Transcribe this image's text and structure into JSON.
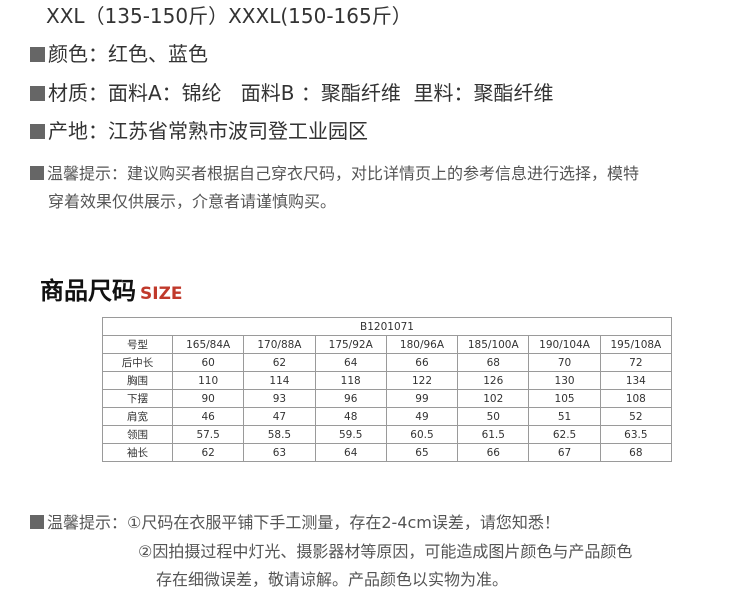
{
  "sizes_line": "XXL（135-150斤）XXXL(150-165斤）",
  "specs": {
    "color": "颜色：红色、蓝色",
    "material": "材质：面料A：锦纶   面料B ：聚酯纤维  里料：聚酯纤维",
    "origin": "产地：江苏省常熟市波司登工业园区"
  },
  "tip": {
    "line1": "温馨提示：建议购买者根据自己穿衣尺码，对比详情页上的参考信息进行选择，模特",
    "line2": "穿着效果仅供展示，介意者请谨慎购买。"
  },
  "size_section": {
    "title_cn": "商品尺码",
    "title_en": "SIZE"
  },
  "size_table": {
    "code": "B1201071",
    "header": [
      "号型",
      "165/84A",
      "170/88A",
      "175/92A",
      "180/96A",
      "185/100A",
      "190/104A",
      "195/108A"
    ],
    "rows": [
      [
        "后中长",
        "60",
        "62",
        "64",
        "66",
        "68",
        "70",
        "72"
      ],
      [
        "胸围",
        "110",
        "114",
        "118",
        "122",
        "126",
        "130",
        "134"
      ],
      [
        "下摆",
        "90",
        "93",
        "96",
        "99",
        "102",
        "105",
        "108"
      ],
      [
        "肩宽",
        "46",
        "47",
        "48",
        "49",
        "50",
        "51",
        "52"
      ],
      [
        "领围",
        "57.5",
        "58.5",
        "59.5",
        "60.5",
        "61.5",
        "62.5",
        "63.5"
      ],
      [
        "袖长",
        "62",
        "63",
        "64",
        "65",
        "66",
        "67",
        "68"
      ]
    ]
  },
  "notes": {
    "line1": "温馨提示：①尺码在衣服平铺下手工测量，存在2-4cm误差，请您知悉！",
    "line2": "②因拍摄过程中灯光、摄影器材等原因，可能造成图片颜色与产品颜色",
    "line3": "存在细微误差，敬请谅解。产品颜色以实物为准。"
  }
}
